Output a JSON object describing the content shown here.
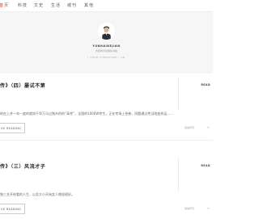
{
  "nav": {
    "items": [
      {
        "label": "首页",
        "active": true
      },
      {
        "label": "科技"
      },
      {
        "label": "文史"
      },
      {
        "label": "生活"
      },
      {
        "label": "城刊"
      },
      {
        "label": "其他"
      }
    ]
  },
  "hero": {
    "site_name": "YUNHAIKEJIAN",
    "description": "风起时仍然保持书籍",
    "motto": "I COUD THEREFORE I AM"
  },
  "posts": [
    {
      "title": "传》（四）屡试不第",
      "side_label": "READ",
      "excerpt": "的在上并一年一度的就如千军万马过独木桥的“高考”，全国的1000W考生，正在考场上答卷，同题通过考试改变命运……",
      "button_label": "UE READING",
      "date": "某某年月",
      "arrow": "→"
    },
    {
      "title": "传》（三）风流才子",
      "side_label": "READ",
      "excerpt": "独三艺开绘看的人生，以及大小开始女人缘很很好。",
      "button_label": "UE READING",
      "date": "某某年月",
      "arrow": "→"
    }
  ],
  "colors": {
    "accent": "#c0392b",
    "hero_bg": "#f6f6f6",
    "border": "#eeeeee"
  }
}
